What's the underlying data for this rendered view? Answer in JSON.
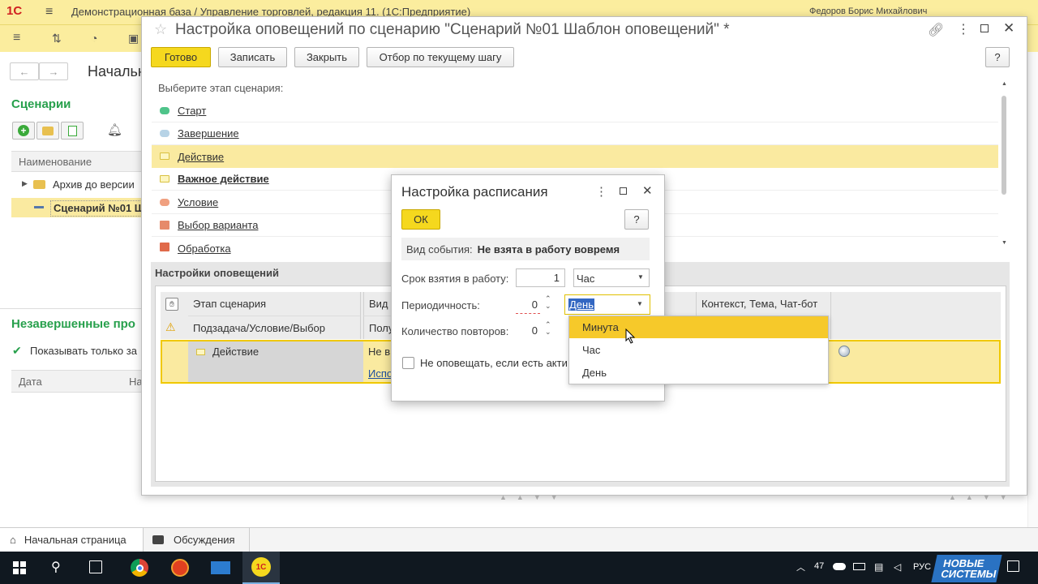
{
  "titlebar": {
    "title": "Демонстрационная база / Управление торговлей, редакция 11. (1С:Предприятие)",
    "user": "Федоров Борис Михайлович"
  },
  "bg": {
    "nav_title": "Начальн",
    "scenarios_title": "Сценарии",
    "col_name": "Наименование",
    "tree": [
      {
        "label": "Архив до версии"
      },
      {
        "label": "Сценарий №01 Ш"
      }
    ],
    "incomplete_title": "Незавершенные про",
    "checkbox_label": "Показывать только за",
    "col_date": "Дата",
    "col_na": "На"
  },
  "main_window": {
    "title": "Настройка оповещений по сценарию \"Сценарий №01 Шаблон оповещений\" *",
    "buttons": {
      "done": "Готово",
      "save": "Записать",
      "close": "Закрыть",
      "filter": "Отбор по текущему шагу",
      "help": "?"
    },
    "choose_stage_label": "Выберите этап сценария:",
    "stages": [
      {
        "label": "Старт",
        "color": "#4fc48a"
      },
      {
        "label": "Завершение",
        "color": "#b7d3e6"
      },
      {
        "label": "Действие",
        "color": "#f4e88a"
      },
      {
        "label": "Важное действие",
        "color": "#f4e88a"
      },
      {
        "label": "Условие",
        "color": "#f0a080"
      },
      {
        "label": "Выбор варианта",
        "color": "#e68a6a"
      },
      {
        "label": "Обработка",
        "color": "#e06a4a"
      }
    ],
    "settings_title": "Настройки оповещений",
    "table": {
      "col1": "Этап сценария",
      "col1b": "Подзадача/Условие/Выбор",
      "col2": "Вид",
      "col2b": "Полу",
      "col3": "Контекст, Тема, Чат-бот",
      "row_stage": "Действие",
      "row_kind": "Не в",
      "row_link": "Испо"
    }
  },
  "dialog": {
    "title": "Настройка расписания",
    "ok": "ОК",
    "help": "?",
    "event_label": "Вид события:",
    "event_value": "Не взята в работу вовремя",
    "deadline_label": "Срок взятия в работу:",
    "deadline_value": "1",
    "deadline_unit": "Час",
    "period_label": "Периодичность:",
    "period_value": "0",
    "period_unit": "День",
    "repeats_label": "Количество повторов:",
    "repeats_value": "0",
    "no_notify_label": "Не оповещать, если есть акти"
  },
  "dropdown": {
    "options": [
      "Минута",
      "Час",
      "День"
    ],
    "highlighted": "Минута"
  },
  "bottom_tabs": {
    "home": "Начальная страница",
    "discussions": "Обсуждения"
  },
  "taskbar": {
    "temp": "47",
    "lang": "РУС",
    "brand_line1": "НОВЫЕ",
    "brand_line2": "СИСТЕМЫ"
  },
  "colors": {
    "accent": "#f5d81e",
    "highlight_row": "#faeaa0",
    "green_title": "#27a04c"
  }
}
